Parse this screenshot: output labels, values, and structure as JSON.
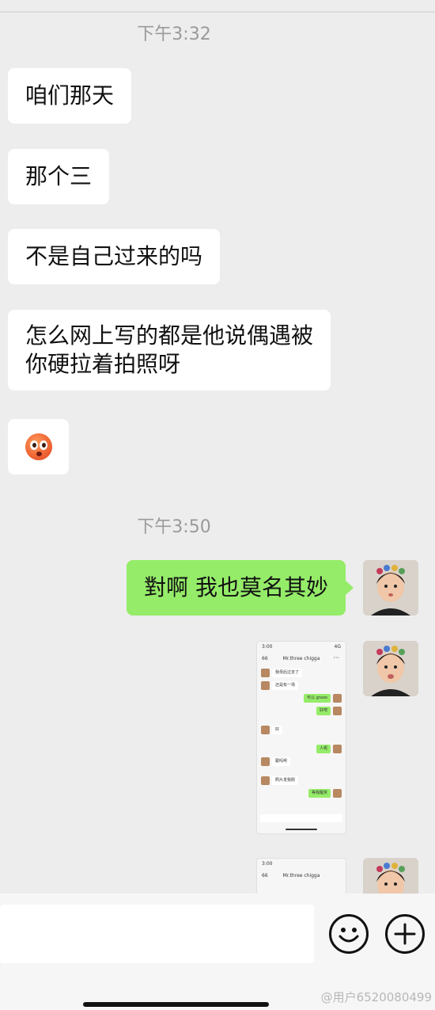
{
  "timestamps": [
    "下午3:32",
    "下午3:50"
  ],
  "messages_in": [
    {
      "text": "咱们那天"
    },
    {
      "text": "那个三"
    },
    {
      "text": "不是自己过来的吗"
    },
    {
      "lines": [
        "怎么网上写的都是他说偶遇被",
        "你硬拉着拍照呀"
      ]
    },
    {
      "emoji": "flushed-face-emoji"
    }
  ],
  "message_out": {
    "text": "對啊 我也莫名其妙"
  },
  "screenshot_thumb": {
    "status_time": "3:00",
    "status_right": "4G",
    "title": "Mr.three chigga",
    "badge": "66",
    "rows": [
      {
        "dir": "in",
        "text": "我母后过去了"
      },
      {
        "dir": "in",
        "text": "还是有一场"
      },
      {
        "dir": "out",
        "text": "可以 graoo"
      },
      {
        "dir": "out",
        "text": "好吧"
      },
      {
        "dir": "in",
        "text": "好"
      },
      {
        "dir": "out",
        "text": "人呢"
      },
      {
        "dir": "in",
        "text": "跟吗咧"
      },
      {
        "dir": "in",
        "text": "照片发我刚"
      },
      {
        "dir": "out",
        "text": "等我醒奖"
      }
    ]
  },
  "screenshot_thumb2": {
    "status_time": "3:00",
    "title": "Mr.three chigga",
    "badge": "66"
  },
  "watermark": "@用户6520080499",
  "icons": {
    "emoji_button": "emoji-smile-icon",
    "plus_button": "plus-icon"
  }
}
